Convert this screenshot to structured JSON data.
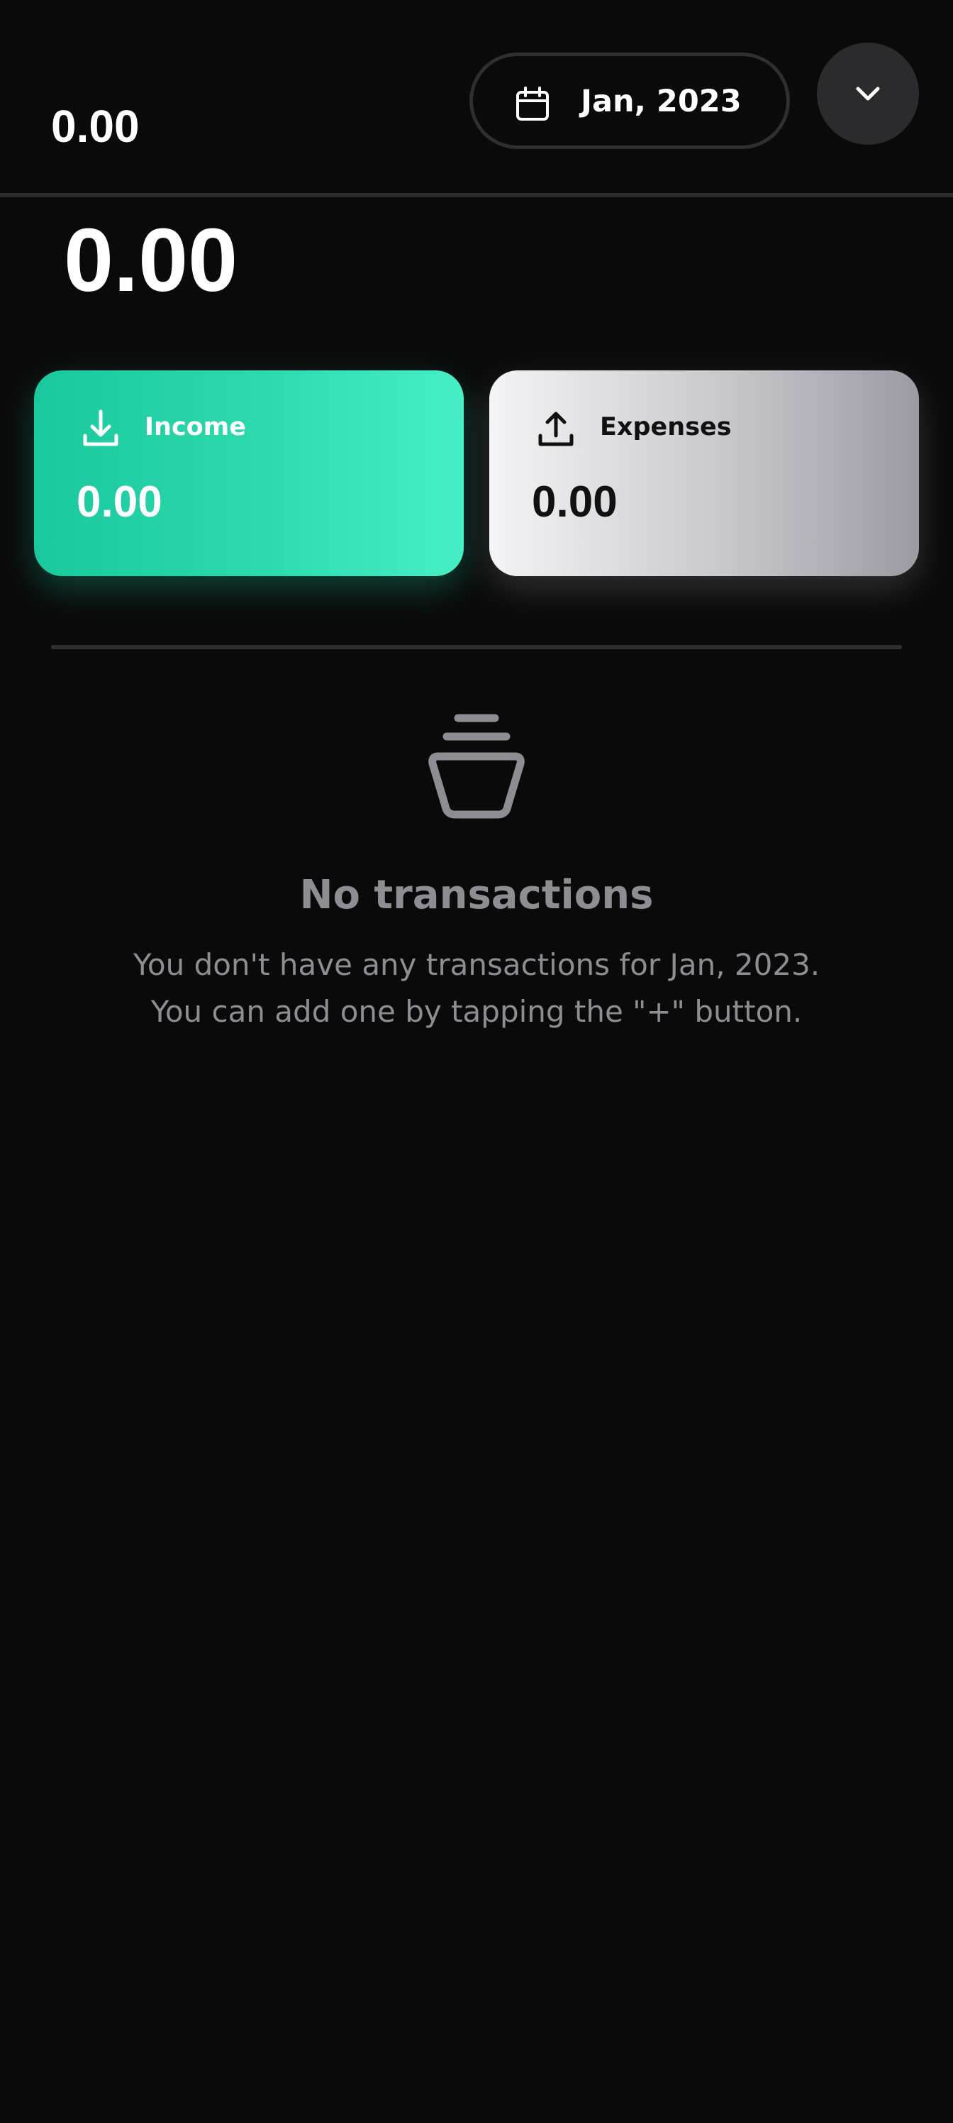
{
  "header": {
    "balance": "0.00",
    "month_picker": {
      "label": "Jan, 2023",
      "icon": "calendar-icon"
    },
    "expand_button": {
      "icon": "chevron-down-icon"
    }
  },
  "summary": {
    "total": "0.00",
    "income": {
      "label": "Income",
      "amount": "0.00",
      "icon": "download-icon",
      "color": "#2bd9ad"
    },
    "expenses": {
      "label": "Expenses",
      "amount": "0.00",
      "icon": "upload-icon",
      "color": "#c8c7cc"
    }
  },
  "empty_state": {
    "icon": "empty-basket-icon",
    "title": "No transactions",
    "line1": "You don't have any transactions for Jan, 2023.",
    "line2": "You can add one by tapping the \"+\" button."
  },
  "colors": {
    "background": "#0a0a0a",
    "muted_text": "#8d8d93",
    "accent": "#2bd9ad"
  }
}
